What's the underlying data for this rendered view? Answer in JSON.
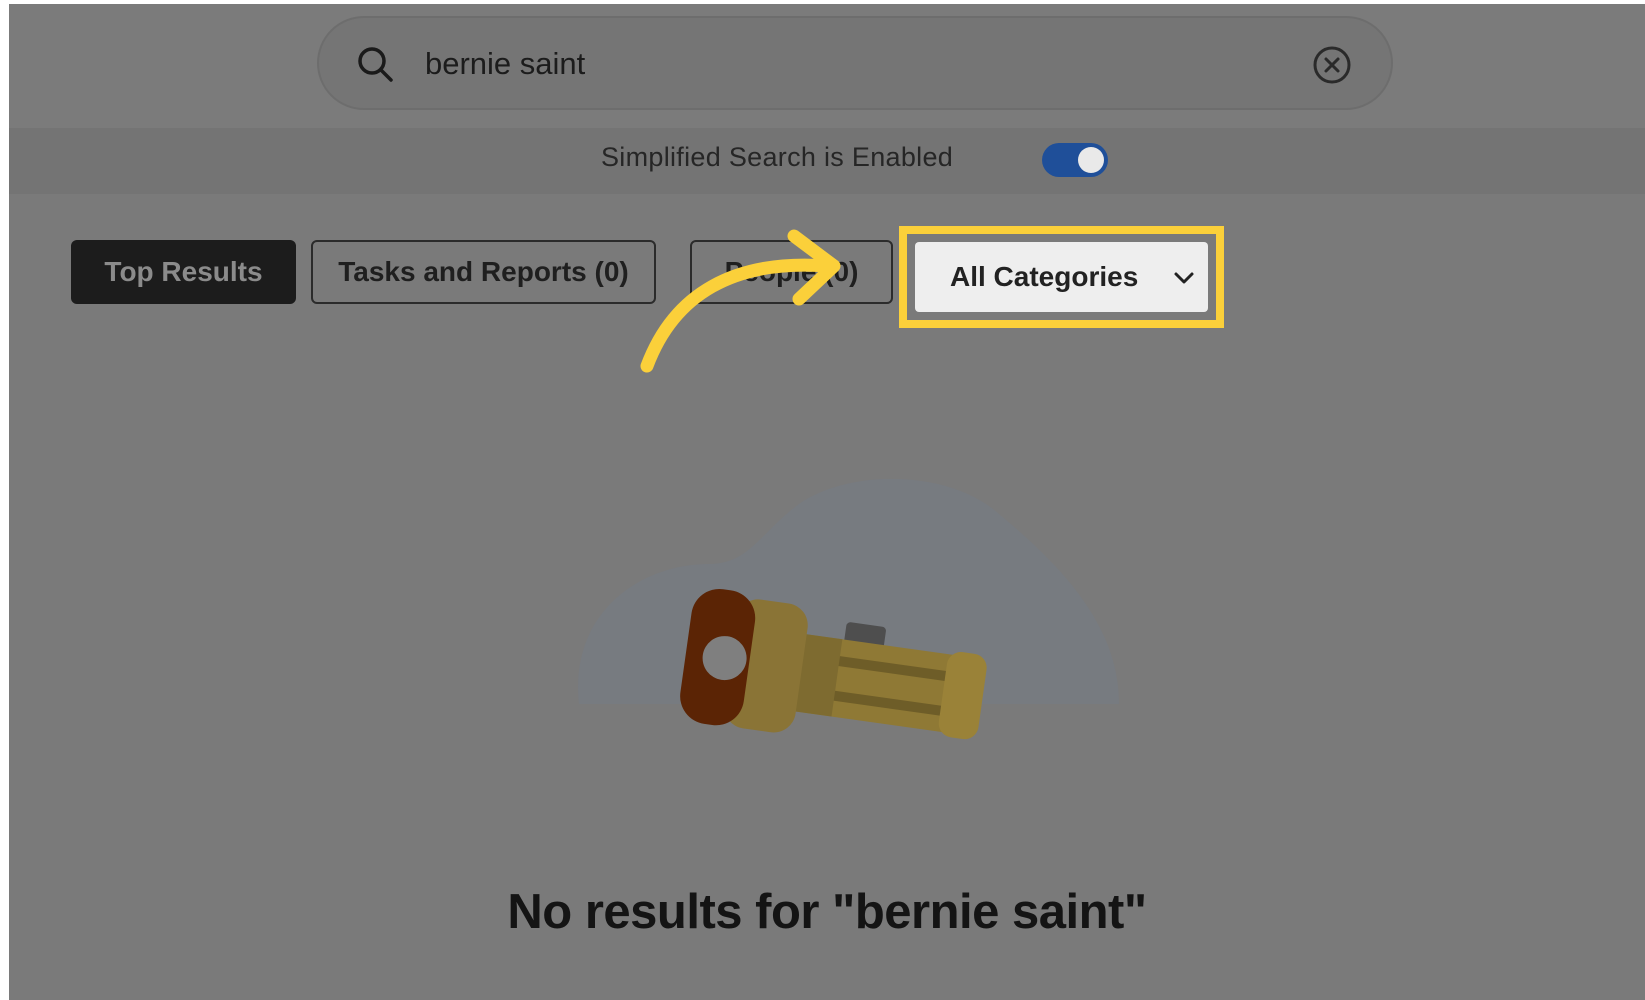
{
  "search": {
    "value": "bernie saint",
    "placeholder": ""
  },
  "simplified": {
    "label": "Simplified Search is Enabled",
    "enabled": true
  },
  "tabs": [
    {
      "label": "Top Results",
      "active": true
    },
    {
      "label": "Tasks and Reports (0)",
      "active": false
    },
    {
      "label": "People (0)",
      "active": false
    }
  ],
  "filter": {
    "label": "All Categories"
  },
  "empty_state": {
    "message": "No results for \"bernie saint\""
  },
  "colors": {
    "highlight": "#fbd03a",
    "toggle_on": "#1f4f99",
    "overlay": "#7a7a7a"
  },
  "icons": {
    "search": "search-icon",
    "clear": "close-circle-icon",
    "dropdown": "chevron-down-icon",
    "illustration": "flashlight-icon",
    "annotation": "curved-arrow-icon"
  }
}
